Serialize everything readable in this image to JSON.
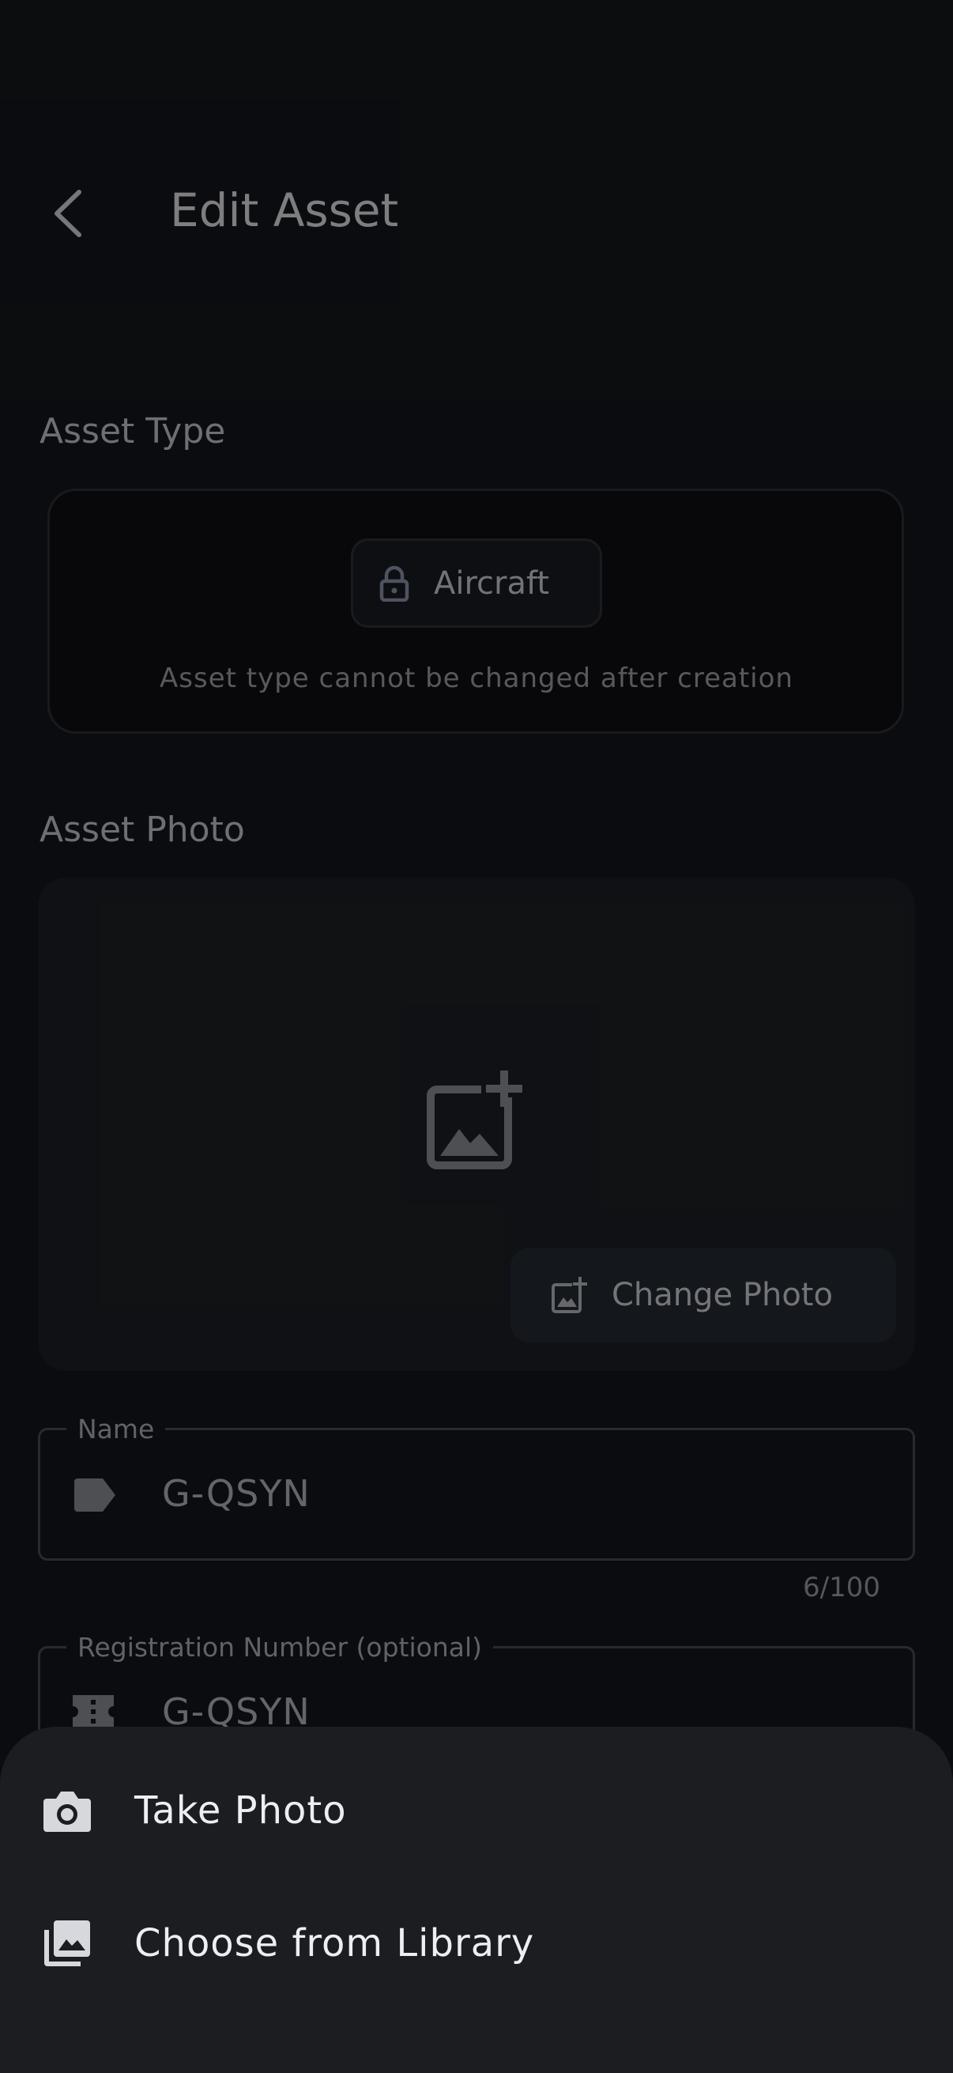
{
  "header": {
    "title": "Edit Asset"
  },
  "asset_type": {
    "section_label": "Asset Type",
    "value": "Aircraft",
    "hint": "Asset type cannot be changed after creation"
  },
  "asset_photo": {
    "section_label": "Asset Photo",
    "change_button": "Change Photo"
  },
  "fields": {
    "name": {
      "label": "Name",
      "value": "G-QSYN",
      "counter": "6/100"
    },
    "registration": {
      "label": "Registration Number (optional)",
      "value": "G-QSYN"
    }
  },
  "sheet": {
    "items": [
      {
        "label": "Take Photo",
        "icon": "camera-icon"
      },
      {
        "label": "Choose from Library",
        "icon": "photo-library-icon"
      }
    ]
  }
}
